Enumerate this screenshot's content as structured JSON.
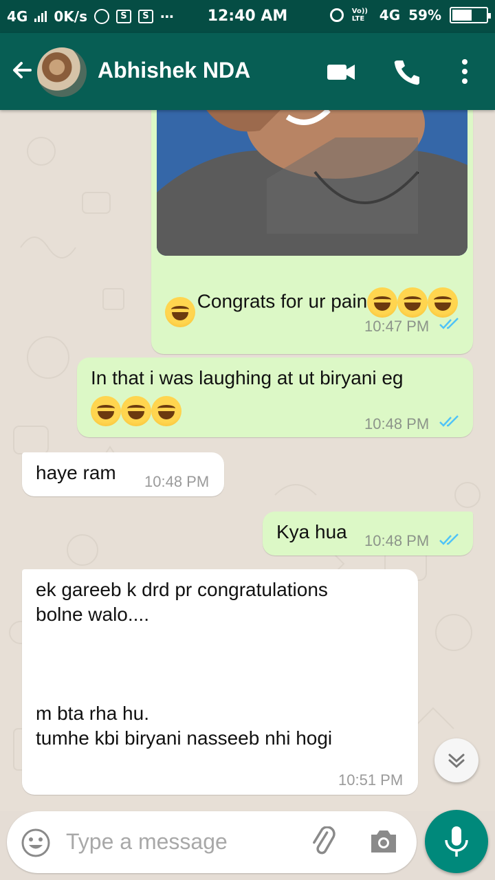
{
  "status_bar": {
    "network_left": "4G",
    "speed": "0K/s",
    "time": "12:40 AM",
    "volte": "Vo)) LTE",
    "network_right": "4G",
    "battery_text": "59%",
    "battery_level": 0.59
  },
  "header": {
    "contact_name": "Abhishek NDA"
  },
  "messages": [
    {
      "type": "out",
      "text": "Congrats for ur pain",
      "emoji_count_line1": 3,
      "emoji_count_line2": 1,
      "time": "10:47 PM",
      "status": "read"
    },
    {
      "type": "out",
      "text": "In that i was laughing at ut biryani eg",
      "emoji_count": 3,
      "time": "10:48 PM",
      "status": "read"
    },
    {
      "type": "in",
      "text": "haye ram",
      "time": "10:48 PM"
    },
    {
      "type": "out",
      "text": "Kya hua",
      "time": "10:48 PM",
      "status": "read"
    },
    {
      "type": "in",
      "text": "ek gareeb k drd pr congratulations\nbolne walo....\n\n\n\nm bta rha hu.\ntumhe kbi biryani nasseeb nhi hogi",
      "time": "10:51 PM"
    }
  ],
  "composer": {
    "placeholder": "Type a message"
  },
  "colors": {
    "header": "#075e54",
    "status_bar": "#054d44",
    "outgoing_bubble": "#dcf8c6",
    "incoming_bubble": "#ffffff",
    "read_ticks": "#4fc3f7",
    "mic_button": "#00897b"
  },
  "icons": [
    "back-arrow-icon",
    "video-call-icon",
    "phone-icon",
    "more-vert-icon",
    "double-check-icon",
    "chevrons-down-icon",
    "emoji-icon",
    "attach-icon",
    "camera-icon",
    "mic-icon"
  ]
}
